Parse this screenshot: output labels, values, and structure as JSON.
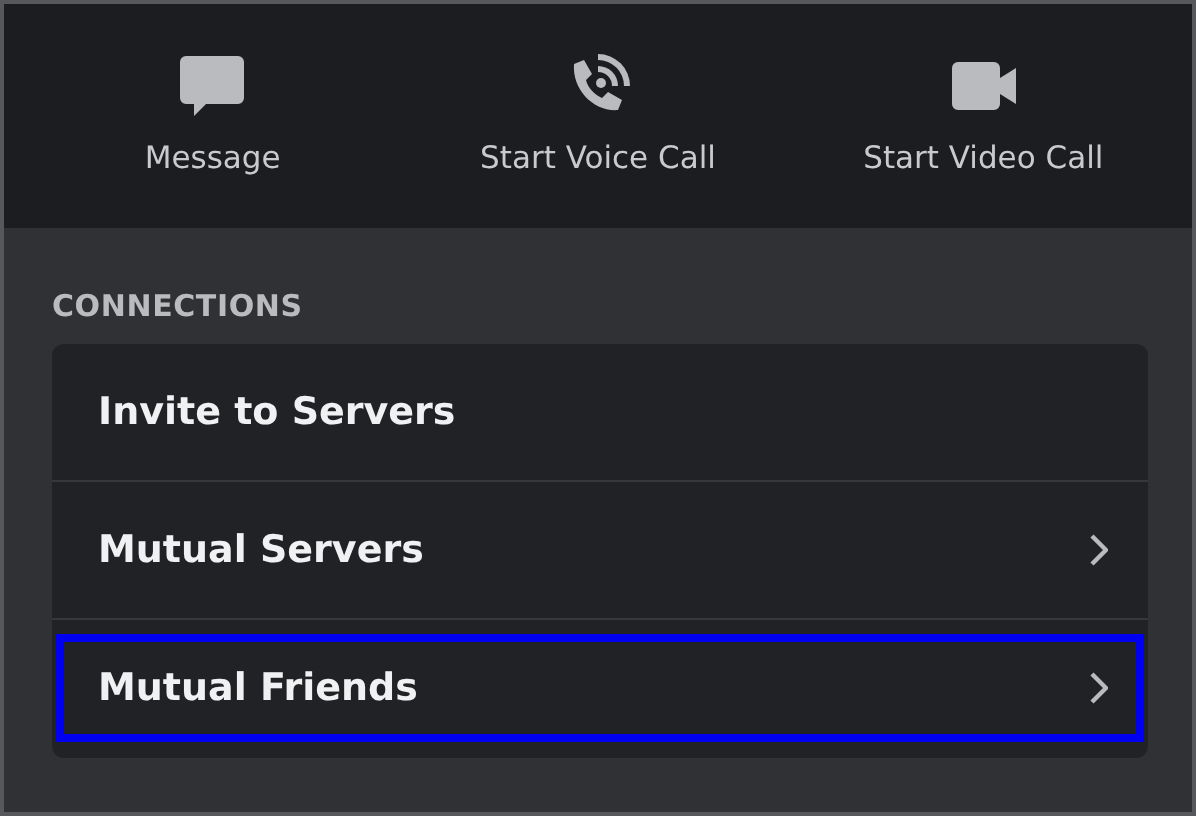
{
  "actions": [
    {
      "kind": "message",
      "label": "Message"
    },
    {
      "kind": "voice",
      "label": "Start Voice Call"
    },
    {
      "kind": "video",
      "label": "Start Video Call"
    }
  ],
  "connections": {
    "heading": "CONNECTIONS",
    "items": [
      {
        "kind": "plain",
        "label": "Invite to Servers",
        "highlighted": false
      },
      {
        "kind": "link",
        "label": "Mutual Servers",
        "highlighted": false
      },
      {
        "kind": "link",
        "label": "Mutual Friends",
        "highlighted": true
      }
    ]
  }
}
